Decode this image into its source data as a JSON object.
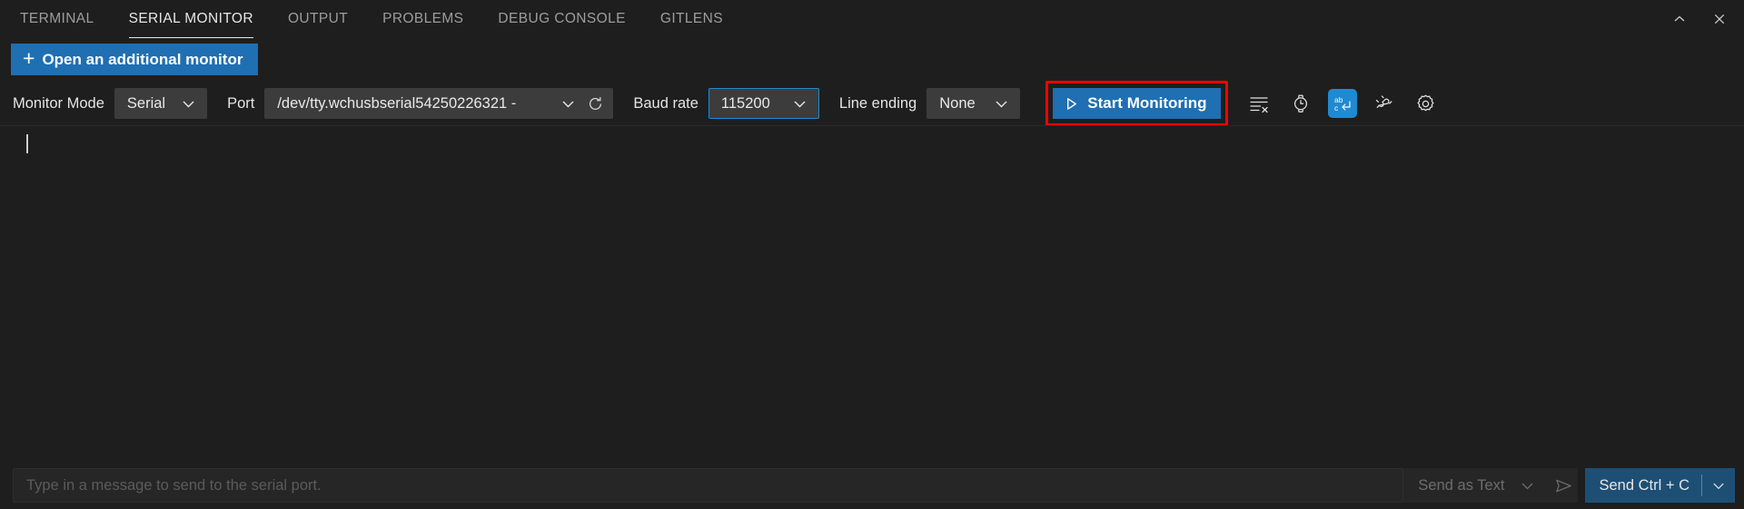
{
  "tabs": [
    {
      "label": "TERMINAL",
      "active": false
    },
    {
      "label": "SERIAL MONITOR",
      "active": true
    },
    {
      "label": "OUTPUT",
      "active": false
    },
    {
      "label": "PROBLEMS",
      "active": false
    },
    {
      "label": "DEBUG CONSOLE",
      "active": false
    },
    {
      "label": "GITLENS",
      "active": false
    }
  ],
  "tabbar_actions": {
    "chevron_up": "chevron-up-icon",
    "close": "close-icon"
  },
  "add_monitor": {
    "label": "Open an additional monitor",
    "plus": "+",
    "background": "#1f6fb2"
  },
  "toolbar": {
    "monitor_mode_label": "Monitor Mode",
    "monitor_mode_value": "Serial",
    "port_label": "Port",
    "port_value": "/dev/tty.wchusbserial54250226321 -",
    "refresh_icon": "refresh-icon",
    "baud_label": "Baud rate",
    "baud_value": "115200",
    "baud_focused": true,
    "line_ending_label": "Line ending",
    "line_ending_value": "None",
    "start_label": "Start Monitoring",
    "start_background": "#1f6fb2",
    "highlight_color": "#ff0000",
    "icons": [
      {
        "name": "clear-output-icon",
        "active": false
      },
      {
        "name": "timestamp-icon",
        "active": false
      },
      {
        "name": "toggle-line-ending-icon",
        "active": true
      },
      {
        "name": "port-connection-icon",
        "active": false
      },
      {
        "name": "settings-gear-icon",
        "active": false
      }
    ]
  },
  "output": {
    "content": "",
    "cursor_visible": true
  },
  "sendbar": {
    "input_value": "",
    "input_placeholder": "Type in a message to send to the serial port.",
    "send_as_label": "Send as Text",
    "send_arrow_icon": "send-icon",
    "ctrl_c_label": "Send Ctrl + C",
    "ctrl_c_background": "#1d4f75"
  }
}
